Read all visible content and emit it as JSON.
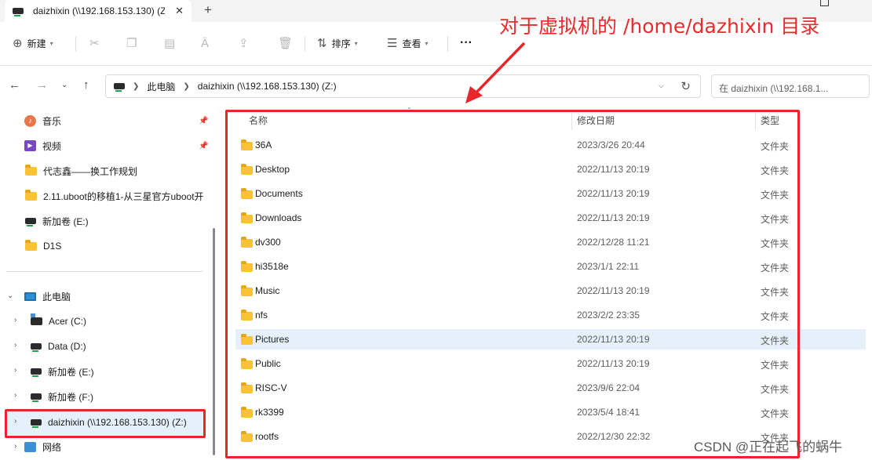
{
  "titlebar": {
    "tab_title": "daizhixin (\\\\192.168.153.130) (Z:)",
    "close_glyph": "✕",
    "new_tab_glyph": "+"
  },
  "toolbar": {
    "new_label": "新建",
    "sort_label": "排序",
    "view_label": "查看",
    "more_glyph": "···",
    "icons": [
      "cut-icon",
      "copy-icon",
      "paste-icon",
      "rename-icon",
      "share-icon",
      "delete-icon"
    ]
  },
  "nav": {
    "breadcrumb": [
      "此电脑",
      "daizhixin (\\\\192.168.153.130) (Z:)"
    ],
    "search_placeholder": "在 daizhixin (\\\\192.168.1..."
  },
  "sidebar": {
    "quick_access": [
      {
        "label": "音乐",
        "icon": "music-icon",
        "pinned": true
      },
      {
        "label": "视频",
        "icon": "video-icon",
        "pinned": true
      },
      {
        "label": "代志鑫——换工作规划",
        "icon": "folder-icon"
      },
      {
        "label": "2.11.uboot的移植1-从三星官方uboot开",
        "icon": "folder-icon"
      },
      {
        "label": "新加卷 (E:)",
        "icon": "drive-icon"
      },
      {
        "label": "D1S",
        "icon": "folder-icon"
      }
    ],
    "this_pc": "此电脑",
    "drives": [
      {
        "label": "Acer (C:)",
        "icon": "os-drive-icon"
      },
      {
        "label": "Data (D:)",
        "icon": "drive-icon"
      },
      {
        "label": "新加卷 (E:)",
        "icon": "drive-icon"
      },
      {
        "label": "新加卷 (F:)",
        "icon": "drive-icon"
      },
      {
        "label": "daizhixin (\\\\192.168.153.130) (Z:)",
        "icon": "network-drive-icon",
        "selected": true
      }
    ],
    "network": "网络"
  },
  "columns": {
    "name": "名称",
    "date": "修改日期",
    "type": "类型"
  },
  "files": [
    {
      "name": "36A",
      "date": "2023/3/26 20:44",
      "type": "文件夹"
    },
    {
      "name": "Desktop",
      "date": "2022/11/13 20:19",
      "type": "文件夹"
    },
    {
      "name": "Documents",
      "date": "2022/11/13 20:19",
      "type": "文件夹"
    },
    {
      "name": "Downloads",
      "date": "2022/11/13 20:19",
      "type": "文件夹"
    },
    {
      "name": "dv300",
      "date": "2022/12/28 11:21",
      "type": "文件夹"
    },
    {
      "name": "hi3518e",
      "date": "2023/1/1 22:11",
      "type": "文件夹"
    },
    {
      "name": "Music",
      "date": "2022/11/13 20:19",
      "type": "文件夹"
    },
    {
      "name": "nfs",
      "date": "2023/2/2 23:35",
      "type": "文件夹"
    },
    {
      "name": "Pictures",
      "date": "2022/11/13 20:19",
      "type": "文件夹",
      "hover": true
    },
    {
      "name": "Public",
      "date": "2022/11/13 20:19",
      "type": "文件夹"
    },
    {
      "name": "RISC-V",
      "date": "2023/9/6 22:04",
      "type": "文件夹"
    },
    {
      "name": "rk3399",
      "date": "2023/5/4 18:41",
      "type": "文件夹"
    },
    {
      "name": "rootfs",
      "date": "2022/12/30 22:32",
      "type": "文件夹"
    }
  ],
  "annotation": {
    "text": "对于虚拟机的 /home/dazhixin 目录",
    "color": "#e8262a"
  },
  "watermark": "CSDN @正在起飞的蜗牛"
}
